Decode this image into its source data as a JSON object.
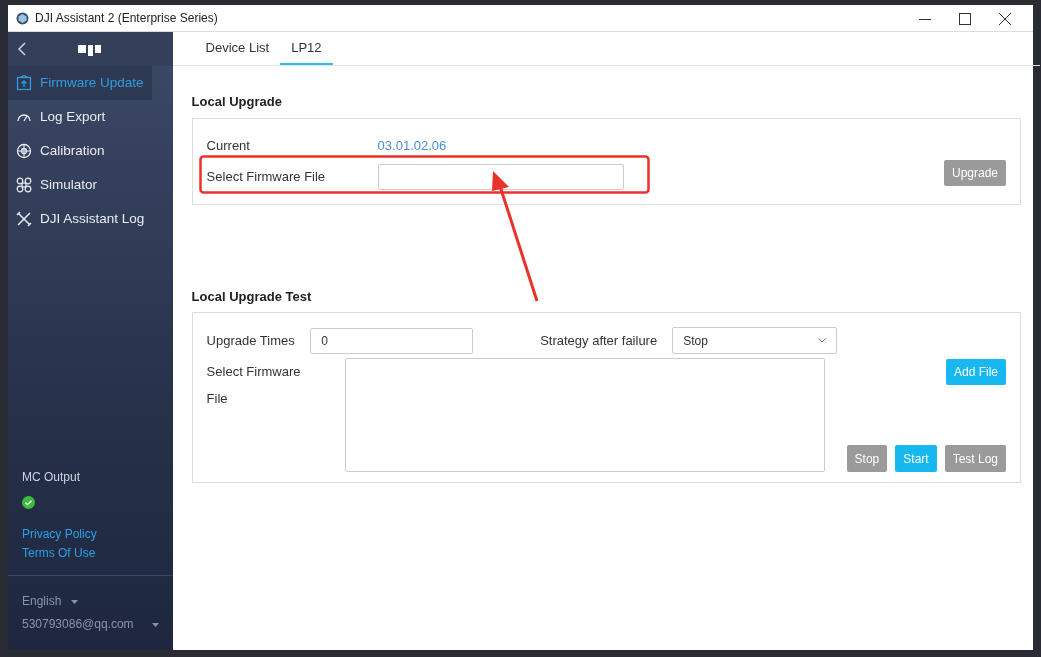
{
  "window": {
    "title": "DJI Assistant 2 (Enterprise Series)"
  },
  "sidebar": {
    "items": [
      {
        "label": "Firmware Update",
        "kind": "firmware",
        "selected": true
      },
      {
        "label": "Log Export",
        "kind": "gauge",
        "selected": false
      },
      {
        "label": "Calibration",
        "kind": "calibration",
        "selected": false
      },
      {
        "label": "Simulator",
        "kind": "drone",
        "selected": false
      },
      {
        "label": "DJI Assistant Log",
        "kind": "tools",
        "selected": false
      }
    ],
    "status_label": "MC Output",
    "status_ok": true,
    "links": [
      "Privacy Policy",
      "Terms Of Use"
    ],
    "language": "English",
    "account": "530793086@qq.com"
  },
  "tabs": [
    {
      "label": "Device List",
      "selected": false
    },
    {
      "label": "LP12",
      "selected": true
    }
  ],
  "local_upgrade": {
    "title": "Local Upgrade",
    "current_label": "Current",
    "current_value": "03.01.02.06",
    "file_label": "Select Firmware File",
    "upgrade_button": {
      "label": "Upgrade",
      "disabled": true
    }
  },
  "local_upgrade_test": {
    "title": "Local Upgrade Test",
    "times_label": "Upgrade Times",
    "times_value": "0",
    "strategy_label": "Strategy after failure",
    "strategy_value": "Stop",
    "file_label": "Select Firmware File",
    "add_button": {
      "label": "Add File",
      "disabled": false
    },
    "buttons": [
      {
        "label": "Stop",
        "disabled": true
      },
      {
        "label": "Start",
        "disabled": false
      },
      {
        "label": "Test Log",
        "disabled": true
      }
    ]
  }
}
